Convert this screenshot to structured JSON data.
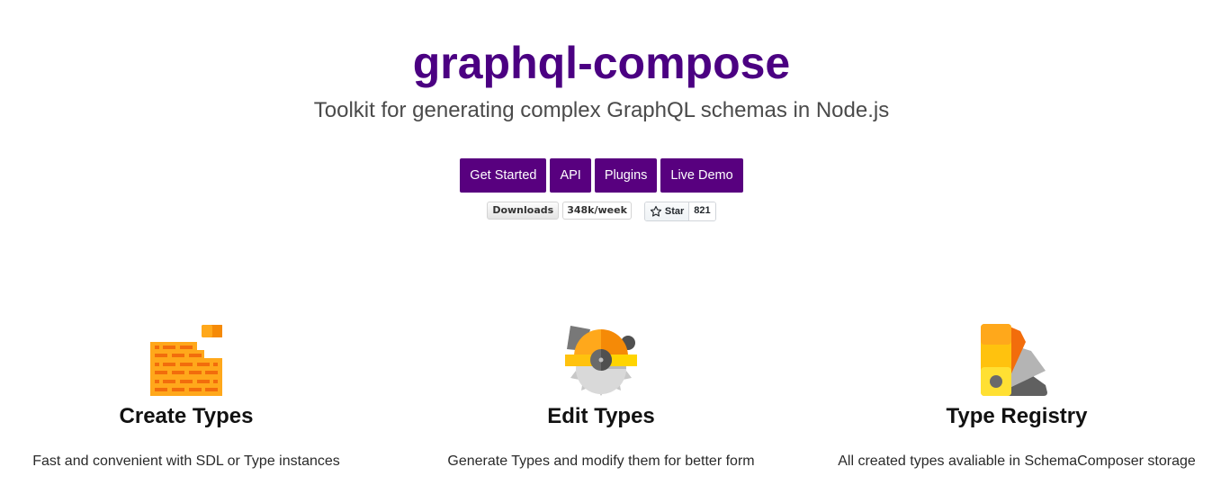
{
  "hero": {
    "title": "graphql-compose",
    "tagline": "Toolkit for generating complex GraphQL schemas in Node.js",
    "buttons": [
      {
        "label": "Get Started"
      },
      {
        "label": "API"
      },
      {
        "label": "Plugins"
      },
      {
        "label": "Live Demo"
      }
    ],
    "badges": {
      "downloads": {
        "label": "Downloads",
        "value": "348k/week"
      },
      "github": {
        "label": "Star",
        "count": "821",
        "icon": "star-icon"
      }
    }
  },
  "features": [
    {
      "icon": "brick-wall-icon",
      "title": "Create Types",
      "description": "Fast and convenient with SDL or Type instances"
    },
    {
      "icon": "circular-saw-icon",
      "title": "Edit Types",
      "description": "Generate Types and modify them for better form"
    },
    {
      "icon": "color-swatch-icon",
      "title": "Type Registry",
      "description": "All created types avaliable in SchemaComposer storage"
    }
  ],
  "colors": {
    "brand": "#4b0082",
    "button": "#58007f"
  }
}
